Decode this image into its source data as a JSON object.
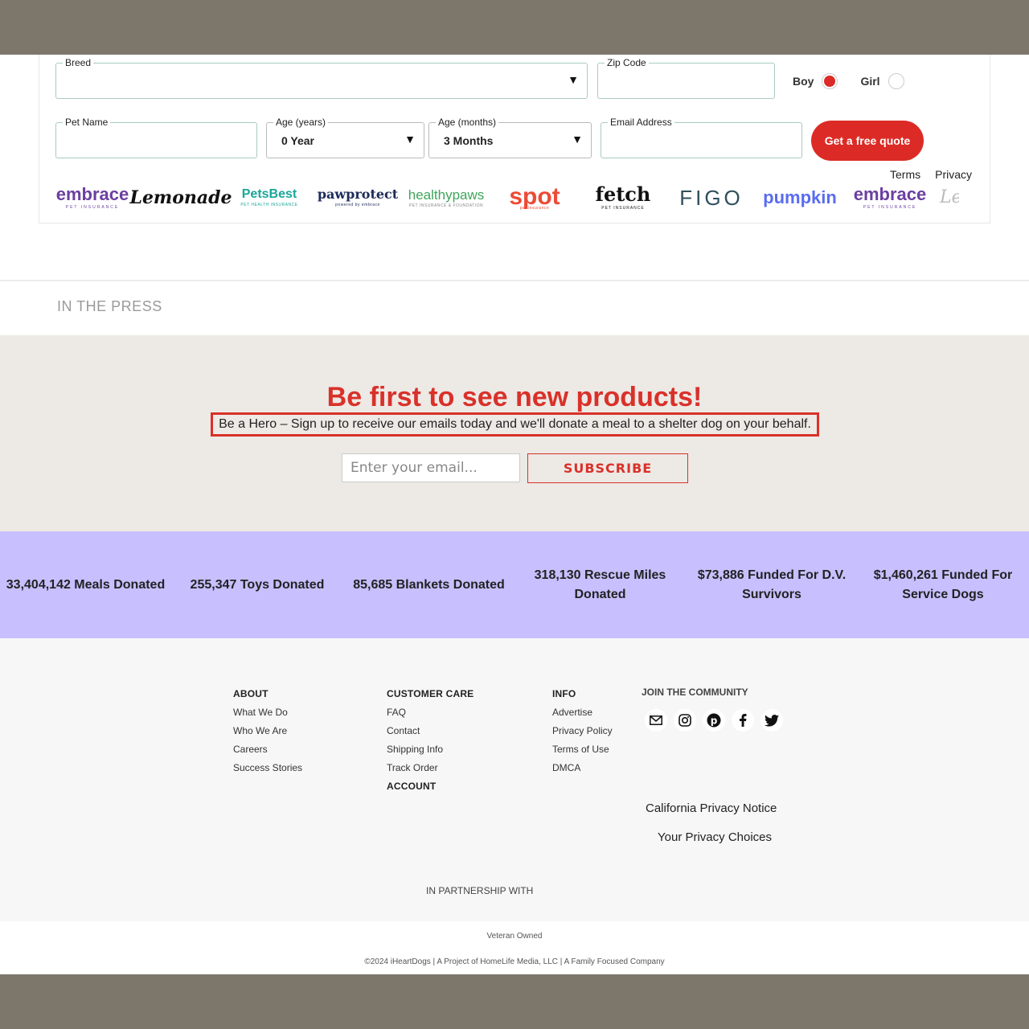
{
  "quote_form": {
    "breed": {
      "label": "Breed",
      "value": ""
    },
    "zip": {
      "label": "Zip Code",
      "value": ""
    },
    "gender": {
      "boy": "Boy",
      "girl": "Girl",
      "selected": "Boy"
    },
    "pet_name": {
      "label": "Pet Name",
      "value": ""
    },
    "age_years": {
      "label": "Age (years)",
      "value": "0 Year"
    },
    "age_months": {
      "label": "Age (months)",
      "value": "3 Months"
    },
    "email": {
      "label": "Email Address",
      "value": ""
    },
    "submit_label": "Get a free quote",
    "terms_label": "Terms",
    "privacy_label": "Privacy"
  },
  "insurer_logos": [
    {
      "name": "embrace",
      "sub": "PET INSURANCE",
      "color": "#6b3fa0"
    },
    {
      "name": "Lemonade",
      "sub": "",
      "color": "#111111"
    },
    {
      "name": "PetsBest",
      "sub": "PET HEALTH INSURANCE",
      "color": "#1aa69a"
    },
    {
      "name": "pawprotect",
      "sub": "powered by embrace",
      "color": "#1c2b5a"
    },
    {
      "name": "healthypaws",
      "sub": "PET INSURANCE & FOUNDATION",
      "color": "#3fa55b"
    },
    {
      "name": "spot",
      "sub": "pet insurance",
      "color": "#ec4b36"
    },
    {
      "name": "fetch",
      "sub": "PET INSURANCE",
      "color": "#111111"
    },
    {
      "name": "FIGO",
      "sub": "",
      "color": "#2f4f5e"
    },
    {
      "name": "pumpkin",
      "sub": "",
      "color": "#5a6cf0"
    },
    {
      "name": "embrace",
      "sub": "PET INSURANCE",
      "color": "#6b3fa0"
    },
    {
      "name": "Le",
      "sub": "",
      "color": "#bbbbbb"
    }
  ],
  "press": {
    "title": "IN THE PRESS"
  },
  "signup": {
    "title": "Be first to see new products!",
    "subtitle": "Be a Hero – Sign up to receive our emails today and we'll donate a meal to a shelter dog on your behalf.",
    "email_placeholder": "Enter your email...",
    "subscribe_label": "SUBSCRIBE"
  },
  "stats": [
    "33,404,142 Meals Donated",
    "255,347 Toys Donated",
    "85,685 Blankets Donated",
    "318,130 Rescue Miles Donated",
    "$73,886 Funded For D.V. Survivors",
    "$1,460,261 Funded For Service Dogs"
  ],
  "footer": {
    "about": {
      "heading": "ABOUT",
      "links": [
        "What We Do",
        "Who We Are",
        "Careers",
        "Success Stories"
      ]
    },
    "care": {
      "heading": "CUSTOMER CARE",
      "links": [
        "FAQ",
        "Contact",
        "Shipping Info",
        "Track Order"
      ],
      "account_heading": "ACCOUNT"
    },
    "info": {
      "heading": "INFO",
      "links": [
        "Advertise",
        "Privacy Policy",
        "Terms of Use",
        "DMCA"
      ]
    },
    "community": {
      "heading": "JOIN THE COMMUNITY",
      "icons": [
        "email-icon",
        "instagram-icon",
        "pinterest-icon",
        "facebook-icon",
        "twitter-icon"
      ],
      "california_notice": "California Privacy Notice",
      "privacy_choices": "Your Privacy Choices"
    },
    "partnership": "IN PARTNERSHIP WITH",
    "veteran": "Veteran Owned",
    "copyright": "©2024 iHeartDogs | A Project of HomeLife Media, LLC | A Family Focused Company"
  },
  "colors": {
    "accent": "#dc2b26",
    "stats_bg": "#c8bfff",
    "signup_bg": "#ede9e5"
  }
}
